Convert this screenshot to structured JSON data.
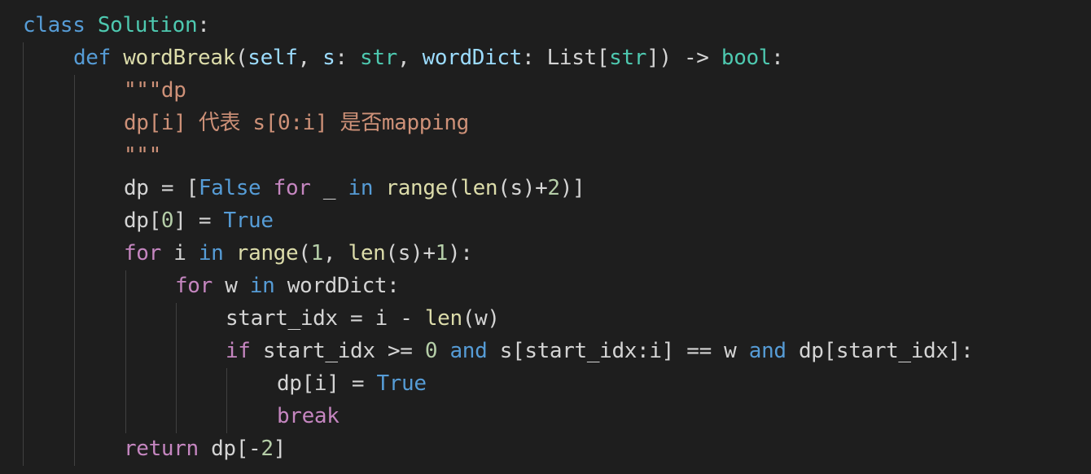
{
  "code": {
    "line1": {
      "kw_class": "class",
      "name": "Solution",
      "colon": ":"
    },
    "line2": {
      "kw_def": "def",
      "fn": "wordBreak",
      "open": "(",
      "self": "self",
      "comma1": ", ",
      "p_s": "s",
      "c1": ": ",
      "t_str": "str",
      "comma2": ", ",
      "p_wd": "wordDict",
      "c2": ": ",
      "t_list": "List",
      "lb": "[",
      "t_str2": "str",
      "rb_arrow": "]) -> ",
      "t_bool": "bool",
      "colon": ":"
    },
    "line3": {
      "text": "\"\"\"dp"
    },
    "line4": {
      "text": "dp[i] 代表 s[0:i] 是否mapping"
    },
    "line5": {
      "text": "\"\"\""
    },
    "line6": {
      "a": "dp = [",
      "kw_false": "False",
      "sp1": " ",
      "kw_for": "for",
      "b": " _ ",
      "kw_in": "in",
      "sp2": " ",
      "fn_range": "range",
      "c": "(",
      "fn_len": "len",
      "d": "(s)+",
      "n2": "2",
      "e": ")]"
    },
    "line7": {
      "a": "dp[",
      "n0": "0",
      "b": "] = ",
      "kw_true": "True"
    },
    "line8": {
      "kw_for": "for",
      "a": " i ",
      "kw_in": "in",
      "sp": " ",
      "fn_range": "range",
      "b": "(",
      "n1": "1",
      "c": ", ",
      "fn_len": "len",
      "d": "(s)+",
      "n1b": "1",
      "e": "):"
    },
    "line9": {
      "kw_for": "for",
      "a": " w ",
      "kw_in": "in",
      "b": " wordDict:"
    },
    "line10": {
      "a": "start_idx = i - ",
      "fn_len": "len",
      "b": "(w)"
    },
    "line11": {
      "kw_if": "if",
      "a": " start_idx >= ",
      "n0": "0",
      "sp1": " ",
      "kw_and": "and",
      "b": " s[start_idx:i] == w ",
      "kw_and2": "and",
      "c": " dp[start_idx]:"
    },
    "line12": {
      "a": "dp[i] = ",
      "kw_true": "True"
    },
    "line13": {
      "kw_break": "break"
    },
    "line14": {
      "kw_return": "return",
      "a": " dp[-",
      "n2": "2",
      "b": "]"
    }
  }
}
